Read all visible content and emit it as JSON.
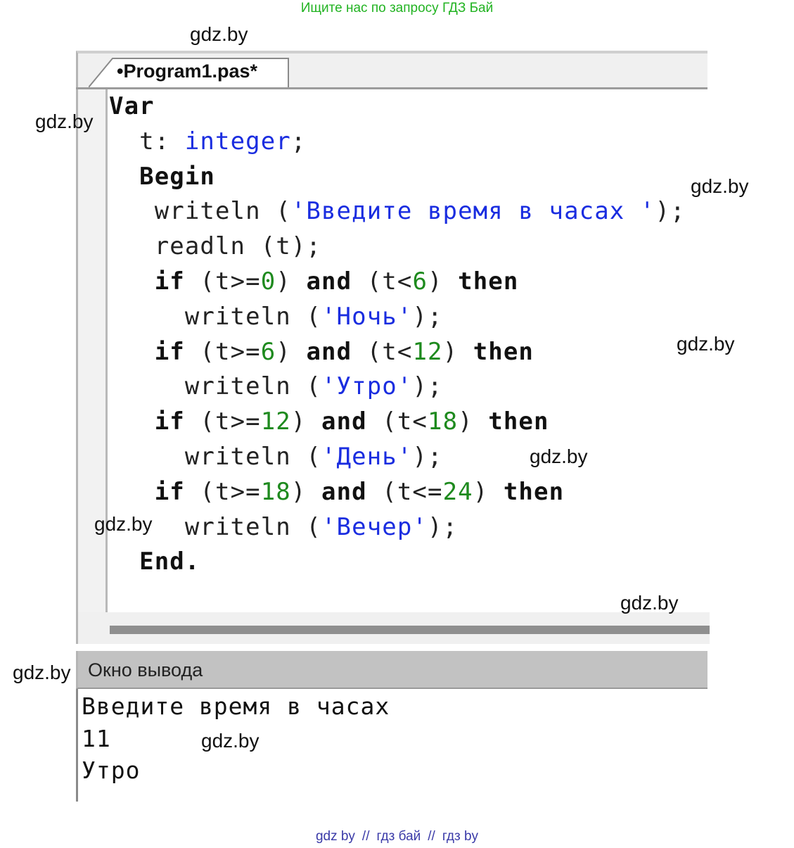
{
  "banner": "Ищите нас по запросу ГДЗ Бай",
  "watermark": "gdz.by",
  "editor": {
    "tab_label": "•Program1.pas*"
  },
  "code_lines": [
    [
      {
        "t": "Var",
        "c": "kw"
      }
    ],
    [
      {
        "t": "  t: ",
        "c": "pl"
      },
      {
        "t": "integer",
        "c": "ty"
      },
      {
        "t": ";",
        "c": "pl"
      }
    ],
    [
      {
        "t": "  Begin",
        "c": "kw"
      }
    ],
    [
      {
        "t": "   writeln (",
        "c": "pl"
      },
      {
        "t": "'Введите время в часах '",
        "c": "st"
      },
      {
        "t": ");",
        "c": "pl"
      }
    ],
    [
      {
        "t": "   readln (t);",
        "c": "pl"
      }
    ],
    [
      {
        "t": "   if",
        "c": "kw"
      },
      {
        "t": " (t>=",
        "c": "pl"
      },
      {
        "t": "0",
        "c": "nm"
      },
      {
        "t": ") ",
        "c": "pl"
      },
      {
        "t": "and",
        "c": "kw"
      },
      {
        "t": " (t<",
        "c": "pl"
      },
      {
        "t": "6",
        "c": "nm"
      },
      {
        "t": ") ",
        "c": "pl"
      },
      {
        "t": "then",
        "c": "kw"
      }
    ],
    [
      {
        "t": "     writeln (",
        "c": "pl"
      },
      {
        "t": "'Ночь'",
        "c": "st"
      },
      {
        "t": ");",
        "c": "pl"
      }
    ],
    [
      {
        "t": "   if",
        "c": "kw"
      },
      {
        "t": " (t>=",
        "c": "pl"
      },
      {
        "t": "6",
        "c": "nm"
      },
      {
        "t": ") ",
        "c": "pl"
      },
      {
        "t": "and",
        "c": "kw"
      },
      {
        "t": " (t<",
        "c": "pl"
      },
      {
        "t": "12",
        "c": "nm"
      },
      {
        "t": ") ",
        "c": "pl"
      },
      {
        "t": "then",
        "c": "kw"
      }
    ],
    [
      {
        "t": "     writeln (",
        "c": "pl"
      },
      {
        "t": "'Утро'",
        "c": "st"
      },
      {
        "t": ");",
        "c": "pl"
      }
    ],
    [
      {
        "t": "   if",
        "c": "kw"
      },
      {
        "t": " (t>=",
        "c": "pl"
      },
      {
        "t": "12",
        "c": "nm"
      },
      {
        "t": ") ",
        "c": "pl"
      },
      {
        "t": "and",
        "c": "kw"
      },
      {
        "t": " (t<",
        "c": "pl"
      },
      {
        "t": "18",
        "c": "nm"
      },
      {
        "t": ") ",
        "c": "pl"
      },
      {
        "t": "then",
        "c": "kw"
      }
    ],
    [
      {
        "t": "     writeln (",
        "c": "pl"
      },
      {
        "t": "'День'",
        "c": "st"
      },
      {
        "t": ");",
        "c": "pl"
      }
    ],
    [
      {
        "t": "   if",
        "c": "kw"
      },
      {
        "t": " (t>=",
        "c": "pl"
      },
      {
        "t": "18",
        "c": "nm"
      },
      {
        "t": ") ",
        "c": "pl"
      },
      {
        "t": "and",
        "c": "kw"
      },
      {
        "t": " (t<=",
        "c": "pl"
      },
      {
        "t": "24",
        "c": "nm"
      },
      {
        "t": ") ",
        "c": "pl"
      },
      {
        "t": "then",
        "c": "kw"
      }
    ],
    [
      {
        "t": "     writeln (",
        "c": "pl"
      },
      {
        "t": "'Вечер'",
        "c": "st"
      },
      {
        "t": ");",
        "c": "pl"
      }
    ],
    [
      {
        "t": "  End.",
        "c": "kw"
      }
    ]
  ],
  "output": {
    "title": "Окно вывода",
    "lines": [
      "Введите время в часах",
      "11",
      "Утро"
    ]
  },
  "footer": {
    "parts": [
      "gdz by",
      "гдз бай",
      "гдз by"
    ],
    "separator": "//"
  },
  "colors": {
    "banner": "#22b322",
    "keyword": "#111111",
    "type": "#1a2de0",
    "string": "#1a2de0",
    "number": "#1e8a1e",
    "footer": "#3a3aa8",
    "output_header": "#c2c2c2"
  }
}
